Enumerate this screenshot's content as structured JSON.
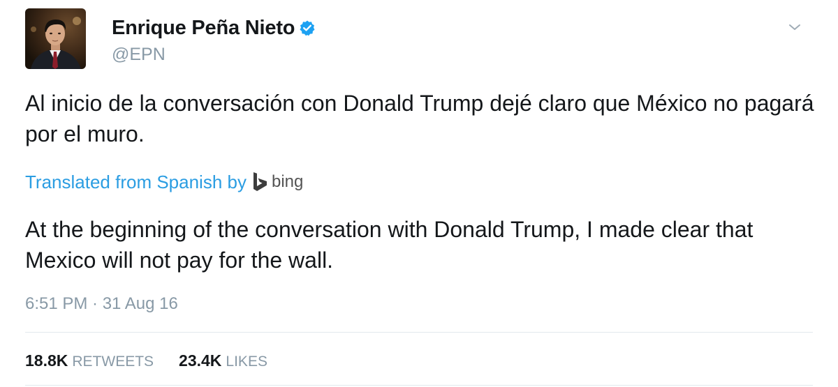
{
  "author": {
    "display_name": "Enrique Peña Nieto",
    "handle": "@EPN",
    "verified": true,
    "avatar": "profile-photo"
  },
  "tweet": {
    "text": "Al inicio de la conversación con Donald Trump dejé claro que México no pagará por el muro.",
    "translation_label": "Translated from Spanish by",
    "translation_provider": "bing",
    "translated_text": "At the beginning of the conversation with Donald Trump, I made clear that Mexico will not pay for the wall.",
    "timestamp": "6:51 PM · 31 Aug 16"
  },
  "stats": {
    "retweets_count": "18.8K",
    "retweets_label": "RETWEETS",
    "likes_count": "23.4K",
    "likes_label": "LIKES"
  },
  "colors": {
    "link_blue": "#2b9de2",
    "verified_blue": "#1da1f2",
    "muted_gray": "#8899a6",
    "text_dark": "#14171a",
    "divider": "#e1e8ed"
  },
  "icons": {
    "verified": "verified-badge-icon",
    "menu": "chevron-down-icon",
    "translator": "bing-logo-icon"
  }
}
